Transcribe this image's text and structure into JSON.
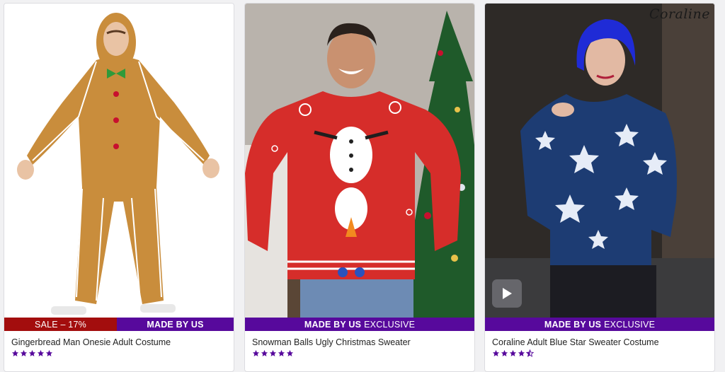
{
  "products": [
    {
      "title": "Gingerbread Man Onesie Adult Costume",
      "sale_label": "SALE – 17%",
      "made_label": "MADE BY US",
      "made_suffix": "",
      "rating": 5,
      "image_icon": "gingerbread-onesie-photo"
    },
    {
      "title": "Snowman Balls Ugly Christmas Sweater",
      "sale_label": "",
      "made_label": "MADE BY US",
      "made_suffix": "EXCLUSIVE",
      "rating": 5,
      "image_icon": "snowman-sweater-photo"
    },
    {
      "title": "Coraline Adult Blue Star Sweater Costume",
      "sale_label": "",
      "made_label": "MADE BY US",
      "made_suffix": "EXCLUSIVE",
      "rating": 4.5,
      "image_icon": "coraline-sweater-photo",
      "brand_logo": "Coraline",
      "has_video": true
    }
  ],
  "colors": {
    "sale_band": "#a30d0d",
    "made_band": "#57099c",
    "star": "#57099c"
  }
}
